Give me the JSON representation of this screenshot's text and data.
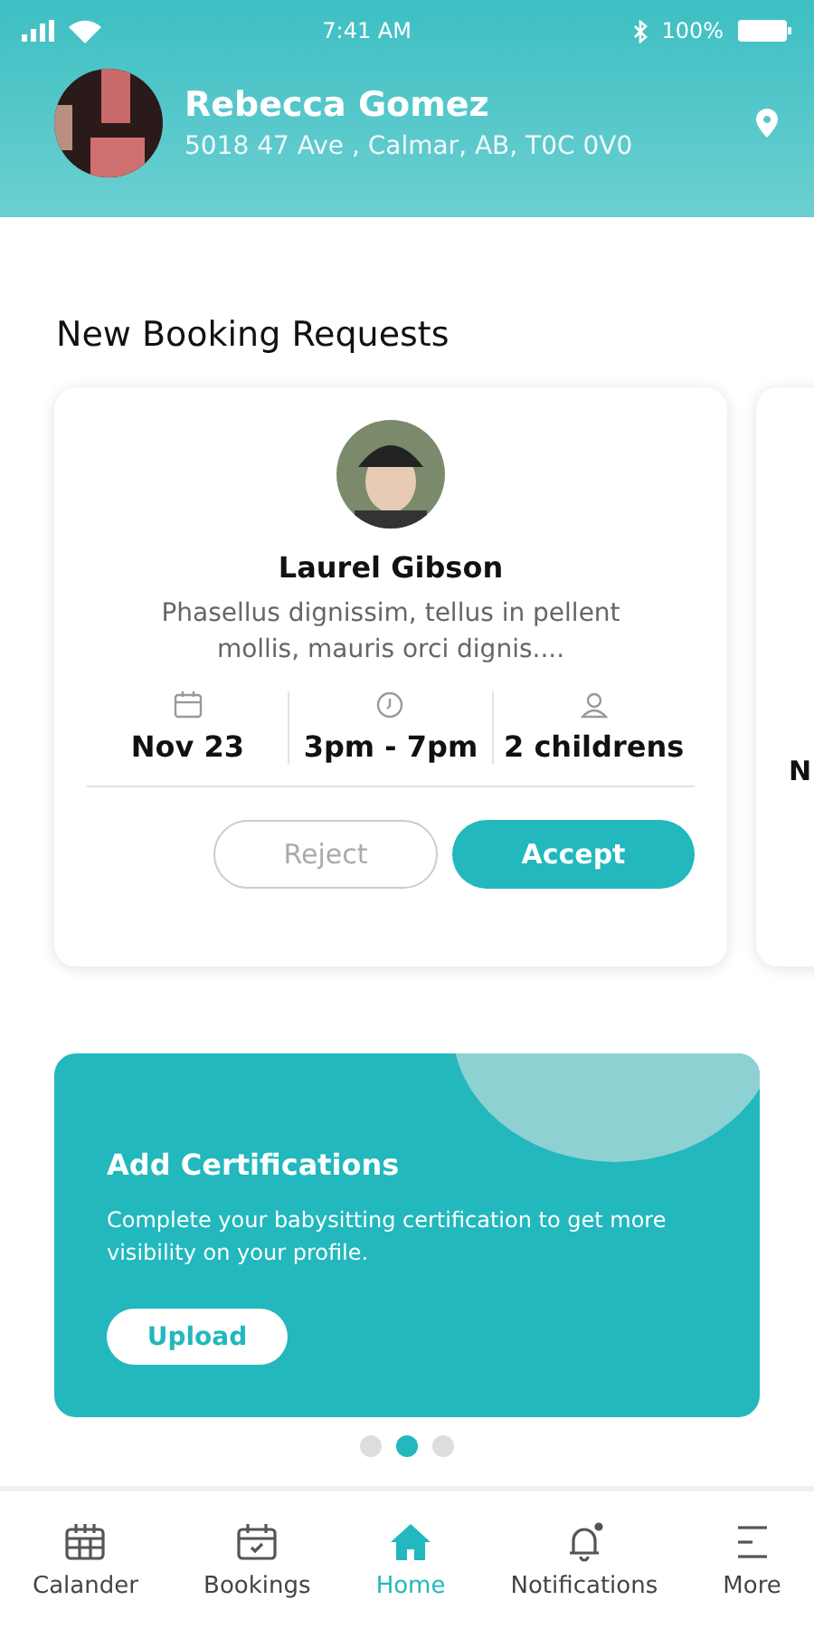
{
  "status_bar": {
    "time": "7:41 AM",
    "battery": "100%"
  },
  "profile": {
    "name": "Rebecca Gomez",
    "address": "5018 47 Ave , Calmar, AB, T0C 0V0"
  },
  "section_title": "New Booking Requests",
  "booking_requests": [
    {
      "name": "Laurel Gibson",
      "message": "Phasellus dignissim, tellus in pellent mollis, mauris orci dignis....",
      "date": "Nov 23",
      "time": "3pm - 7pm",
      "children": "2 childrens",
      "reject": "Reject",
      "accept": "Accept"
    },
    {
      "date": "N"
    }
  ],
  "promo": {
    "title": "Add Certifications",
    "text": "Complete your babysitting certification to get more visibility on your profile.",
    "button": "Upload"
  },
  "pager": [
    {
      "selected": false
    },
    {
      "selected": true
    },
    {
      "selected": false
    }
  ],
  "bottom_nav": [
    {
      "kind": "calendar",
      "label": "Calander",
      "selected": false
    },
    {
      "kind": "bookings",
      "label": "Bookings",
      "selected": false
    },
    {
      "kind": "home",
      "label": "Home",
      "selected": true
    },
    {
      "kind": "notifications",
      "label": "Notifications",
      "selected": false
    },
    {
      "kind": "more",
      "label": "More",
      "selected": false
    }
  ]
}
